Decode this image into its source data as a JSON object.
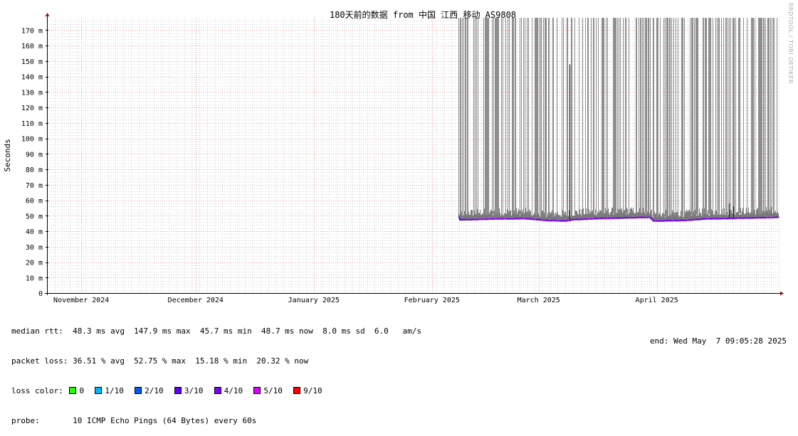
{
  "chart_data": {
    "type": "line",
    "title": "180天前的数据 from 中国 江西 移动 AS9808",
    "ylabel": "Seconds",
    "ylim": [
      0,
      178
    ],
    "y_ticks": [
      {
        "value": 0,
        "label": "0"
      },
      {
        "value": 10,
        "label": "10 m"
      },
      {
        "value": 20,
        "label": "20 m"
      },
      {
        "value": 30,
        "label": "30 m"
      },
      {
        "value": 40,
        "label": "40 m"
      },
      {
        "value": 50,
        "label": "50 m"
      },
      {
        "value": 60,
        "label": "60 m"
      },
      {
        "value": 70,
        "label": "70 m"
      },
      {
        "value": 80,
        "label": "80 m"
      },
      {
        "value": 90,
        "label": "90 m"
      },
      {
        "value": 100,
        "label": "100 m"
      },
      {
        "value": 110,
        "label": "110 m"
      },
      {
        "value": 120,
        "label": "120 m"
      },
      {
        "value": 130,
        "label": "130 m"
      },
      {
        "value": 140,
        "label": "140 m"
      },
      {
        "value": 150,
        "label": "150 m"
      },
      {
        "value": 160,
        "label": "160 m"
      },
      {
        "value": 170,
        "label": "170 m"
      }
    ],
    "xlim": [
      "2024-10-27",
      "2025-05-07"
    ],
    "x_ticks": [
      {
        "date": "2024-11-05",
        "label": "November 2024"
      },
      {
        "date": "2024-12-05",
        "label": "December 2024"
      },
      {
        "date": "2025-01-05",
        "label": "January 2025"
      },
      {
        "date": "2025-02-05",
        "label": "February 2025"
      },
      {
        "date": "2025-03-05",
        "label": "March 2025"
      },
      {
        "date": "2025-04-05",
        "label": "April 2025"
      }
    ],
    "data_start": "2025-02-12",
    "median_rtt": [
      {
        "date": "2025-02-12",
        "value": 47.3
      },
      {
        "date": "2025-02-16",
        "value": 47.6
      },
      {
        "date": "2025-02-22",
        "value": 48.0
      },
      {
        "date": "2025-03-01",
        "value": 48.2
      },
      {
        "date": "2025-03-07",
        "value": 47.0
      },
      {
        "date": "2025-03-12",
        "value": 46.6
      },
      {
        "date": "2025-03-14",
        "value": 47.5
      },
      {
        "date": "2025-03-20",
        "value": 48.2
      },
      {
        "date": "2025-03-28",
        "value": 48.6
      },
      {
        "date": "2025-04-03",
        "value": 49.0
      },
      {
        "date": "2025-04-04",
        "value": 46.6
      },
      {
        "date": "2025-04-12",
        "value": 47.0
      },
      {
        "date": "2025-04-18",
        "value": 48.0
      },
      {
        "date": "2025-04-26",
        "value": 48.4
      },
      {
        "date": "2025-05-07",
        "value": 49.0
      }
    ],
    "spikes": [
      {
        "date": "2025-03-13",
        "value": 147.9
      },
      {
        "date": "2025-04-24",
        "value": 58.0
      },
      {
        "date": "2025-04-25",
        "value": 56.0
      }
    ],
    "grid": true
  },
  "stats": {
    "median_line": "median rtt:  48.3 ms avg  147.9 ms max  45.7 ms min  48.7 ms now  8.0 ms sd  6.0   am/s",
    "loss_line": "packet loss: 36.51 % avg  52.75 % max  15.18 % min  20.32 % now",
    "loss_label": "loss color:",
    "loss_colors": [
      {
        "label": "0",
        "color": "#26ff00"
      },
      {
        "label": "1/10",
        "color": "#00b8ff"
      },
      {
        "label": "2/10",
        "color": "#0059ff"
      },
      {
        "label": "3/10",
        "color": "#5e00ff"
      },
      {
        "label": "4/10",
        "color": "#7e00ff"
      },
      {
        "label": "5/10",
        "color": "#dd00ff"
      },
      {
        "label": "9/10",
        "color": "#ff0000"
      }
    ],
    "probe_line": "probe:       10 ICMP Echo Pings (64 Bytes) every 60s",
    "end_line": "end: Wed May  7 09:05:28 2025"
  },
  "watermark": "RRDTOOL / TOBI OETIKER"
}
